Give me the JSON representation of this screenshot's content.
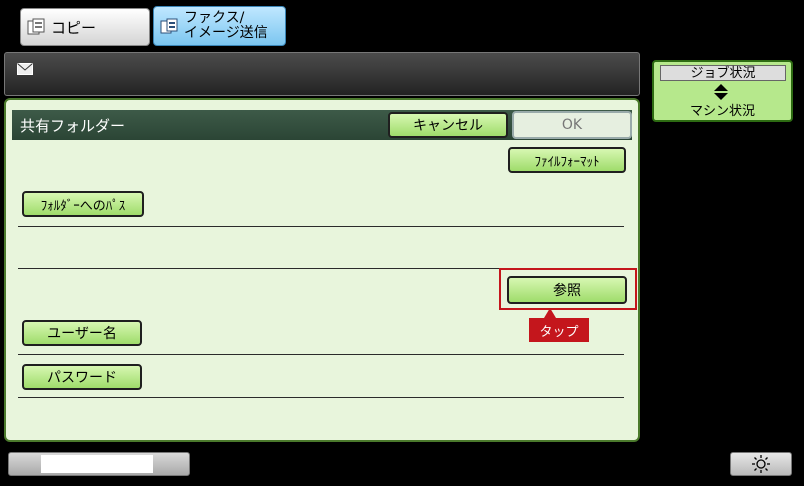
{
  "tabs": {
    "copy": "コピー",
    "fax_line1": "ファクス/",
    "fax_line2": "イメージ送信"
  },
  "job_status": {
    "top": "ジョブ状況",
    "bottom": "マシン状況"
  },
  "panel": {
    "title": "共有フォルダー",
    "cancel": "キャンセル",
    "ok": "OK",
    "file_format": "ﾌｧｲﾙﾌｫｰﾏｯﾄ",
    "folder_path": "ﾌｫﾙﾀﾞｰへのﾊﾟｽ",
    "browse": "参照",
    "user_name": "ユーザー名",
    "password": "パスワード"
  },
  "callout": {
    "tap": "タップ"
  },
  "colors": {
    "accent_green": "#9fdc6b",
    "highlight_red": "#c4161c"
  }
}
